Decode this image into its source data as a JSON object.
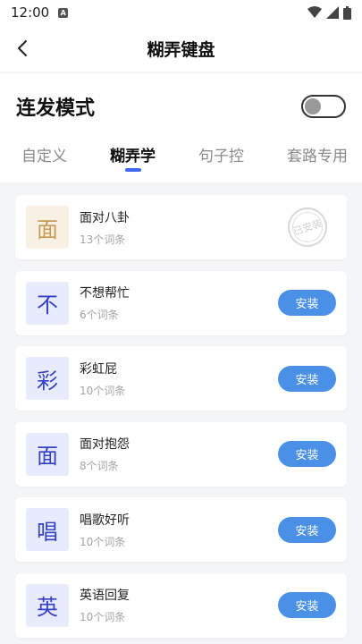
{
  "status_bar": {
    "time": "12:00",
    "notif_letter": "A"
  },
  "header": {
    "title": "糊弄键盘"
  },
  "mode": {
    "label": "连发模式",
    "enabled": false
  },
  "tabs": [
    {
      "label": "自定义",
      "active": false
    },
    {
      "label": "糊弄学",
      "active": true
    },
    {
      "label": "句子控",
      "active": false
    },
    {
      "label": "套路专用",
      "active": false
    }
  ],
  "packs": [
    {
      "char": "面",
      "name": "面对八卦",
      "count": "13个词条",
      "installed": true,
      "stamp": "已安装"
    },
    {
      "char": "不",
      "name": "不想帮忙",
      "count": "6个词条",
      "installed": false,
      "button": "安装"
    },
    {
      "char": "彩",
      "name": "彩虹屁",
      "count": "10个词条",
      "installed": false,
      "button": "安装"
    },
    {
      "char": "面",
      "name": "面对抱怨",
      "count": "8个词条",
      "installed": false,
      "button": "安装"
    },
    {
      "char": "唱",
      "name": "唱歌好听",
      "count": "10个词条",
      "installed": false,
      "button": "安装"
    },
    {
      "char": "英",
      "name": "英语回复",
      "count": "10个词条",
      "installed": false,
      "button": "安装"
    }
  ],
  "colors": {
    "accent": "#3d67f0",
    "install_button": "#4a90e6",
    "thumb_bg": "#e8ebfb",
    "thumb_installed_bg": "#f7f0e3"
  }
}
